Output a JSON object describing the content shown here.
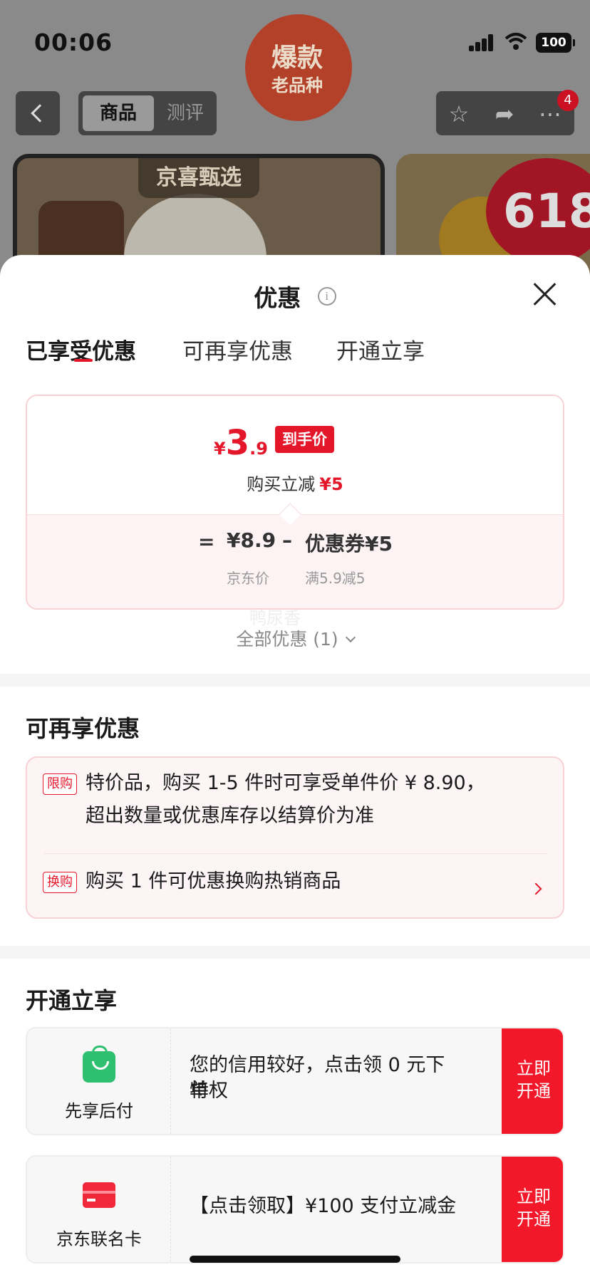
{
  "status_bar": {
    "time": "00:06",
    "battery": "100"
  },
  "header": {
    "tabs": [
      "商品",
      "测评"
    ],
    "cart_badge": "4"
  },
  "banners": {
    "tag": "京喜甄选",
    "hot_big": "爆款",
    "hot_small": "老品种",
    "festival": "618"
  },
  "sheet": {
    "title": "优惠",
    "tabs": [
      "已享受优惠",
      "可再享优惠",
      "开通立享"
    ],
    "price_card": {
      "currency": "¥",
      "final_int": "3",
      "final_dec": ".9",
      "final_badge": "到手价",
      "reduce_label": "购买立减",
      "reduce_value": "¥5",
      "eq": "=",
      "jd_price": "¥8.9",
      "minus": "–",
      "coupon_label": "优惠券¥5",
      "jd_price_label": "京东价",
      "coupon_cond": "满5.9减5"
    },
    "watermark": "鸭尿香",
    "all_promos": "全部优惠 (1)",
    "section_more": {
      "title": "可再享优惠",
      "items": [
        {
          "tag": "限购",
          "text_line1": "特价品，购买 1-5 件时可享受单件价 ¥ 8.90，",
          "text_line2": "超出数量或优惠库存以结算价为准"
        },
        {
          "tag": "换购",
          "text_line1": "购买 1 件可优惠换购热销商品"
        }
      ]
    },
    "section_open": {
      "title": "开通立享",
      "services": [
        {
          "name": "先享后付",
          "desc_line1": "您的信用较好，点击领 0 元下单",
          "desc_line2": "特权",
          "btn_line1": "立即",
          "btn_line2": "开通",
          "icon": "shopping-bag-icon",
          "icon_color": "#2ec070"
        },
        {
          "name": "京东联名卡",
          "desc_line1": "【点击领取】¥100 支付立减金",
          "btn_line1": "立即",
          "btn_line2": "开通",
          "icon": "credit-card-icon",
          "icon_color": "#f0283a"
        }
      ]
    }
  },
  "colors": {
    "accent": "#e4162a",
    "button_red": "#f21829",
    "overlay": "#666666"
  }
}
